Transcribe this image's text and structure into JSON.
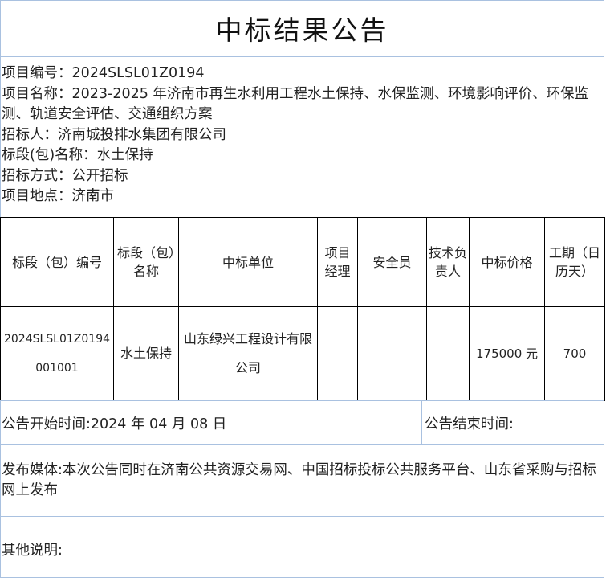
{
  "notice_title": "中标结果公告",
  "project_info": {
    "number": "项目编号：2024SLSL01Z0194",
    "name": "项目名称：2023-2025 年济南市再生水利用工程水土保持、水保监测、环境影响评价、环保监测、轨道安全评估、交通组织方案",
    "tenderer": "招标人：济南城投排水集团有限公司",
    "lot_name": "标段(包)名称：水土保持",
    "method": "招标方式：公开招标",
    "location": "项目地点：济南市"
  },
  "award_table": {
    "headers": [
      "标段（包）编号",
      "标段（包）名称",
      "中标单位",
      "项目经理",
      "安全员",
      "技术负责人",
      "中标价格",
      "工期（日历天）"
    ],
    "rows": [
      {
        "lot_no_line1": "2024SLSL01Z0194",
        "lot_no_line2": "001001",
        "lot_name": "水土保持",
        "winner": "山东绿兴工程设计有限公司",
        "project_manager": "",
        "safety_officer": "",
        "tech_lead": "",
        "price": "175000 元",
        "period": "700"
      }
    ]
  },
  "announcement": {
    "start": "公告开始时间:2024 年 04 月 08 日",
    "end": "公告结束时间:",
    "media": "发布媒体:本次公告同时在济南公共资源交易网、中国招标投标公共服务平台、山东省采购与招标网上发布",
    "other": "其他说明:"
  }
}
